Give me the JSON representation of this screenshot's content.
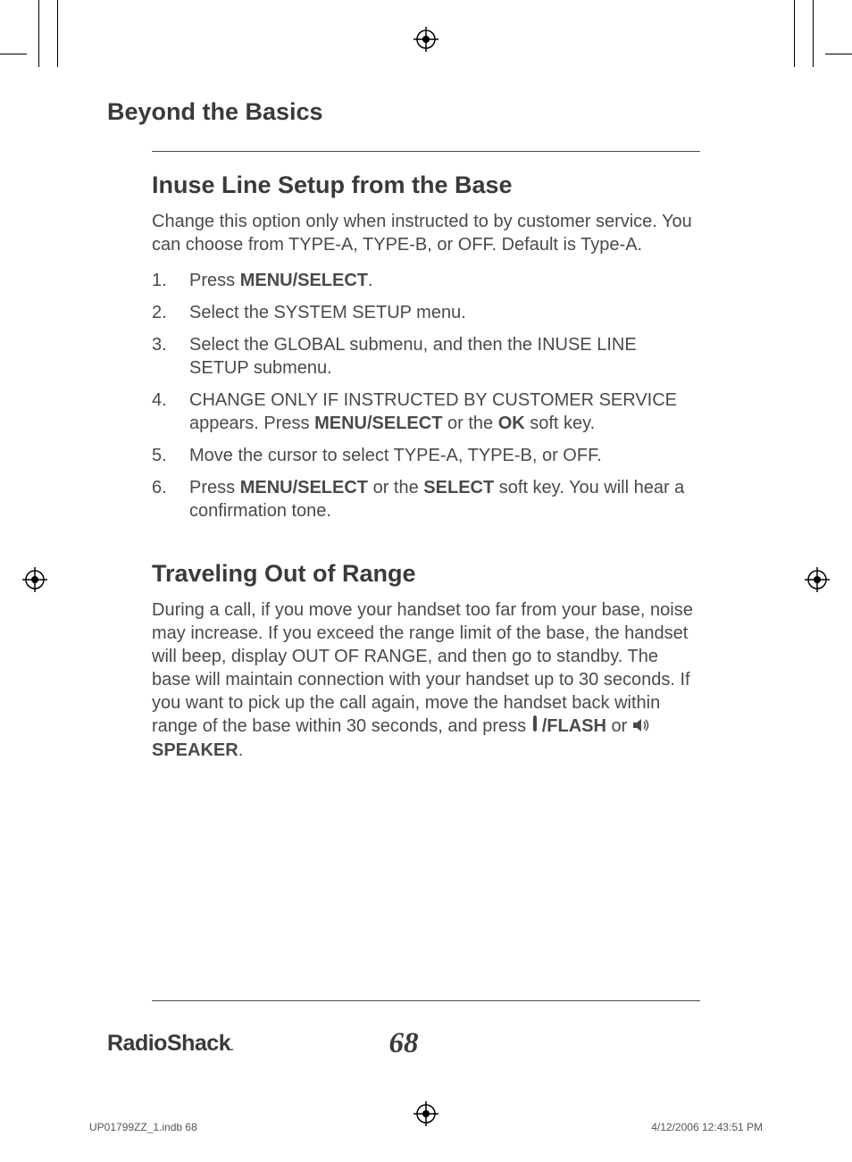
{
  "chapter_title": "Beyond the Basics",
  "section1": {
    "title": "Inuse Line Setup from the Base",
    "intro": "Change this option only when instructed to by customer service. You can choose from TYPE-A, TYPE-B, or OFF. Default is Type-A.",
    "steps": [
      {
        "num": "1.",
        "pre": "Press ",
        "bold1": "MENU/SELECT",
        "post": "."
      },
      {
        "num": "2.",
        "text": "Select the SYSTEM SETUP menu."
      },
      {
        "num": "3.",
        "text": "Select the GLOBAL submenu, and then the INUSE LINE SETUP submenu."
      },
      {
        "num": "4.",
        "pre": "CHANGE ONLY IF INSTRUCTED BY CUSTOMER SERVICE appears. Press ",
        "bold1": "MENU/SELECT",
        "mid": " or the ",
        "bold2": "OK",
        "post": " soft key."
      },
      {
        "num": "5.",
        "text": "Move the cursor to select TYPE-A, TYPE-B, or OFF."
      },
      {
        "num": "6.",
        "pre": "Press ",
        "bold1": "MENU/SELECT",
        "mid": " or the ",
        "bold2": "SELECT",
        "post": " soft key. You will hear a confirmation tone."
      }
    ]
  },
  "section2": {
    "title": "Traveling Out of Range",
    "body_pre": "During a call, if you move your handset too far from your base, noise may increase. If you exceed the range limit of the base, the handset will beep, display OUT OF RANGE, and then go to standby. The base will maintain connection with your handset up to 30 seconds. If you want to pick up the call again, move the handset back within range of the base within 30 seconds, and press ",
    "flash_label": "/FLASH",
    "or_text": " or ",
    "speaker_label": " SPEAKER",
    "period": "."
  },
  "footer": {
    "brand": "RadioShack",
    "page_num": "68"
  },
  "print": {
    "left": "UP01799ZZ_1.indb   68",
    "right": "4/12/2006   12:43:51 PM"
  }
}
